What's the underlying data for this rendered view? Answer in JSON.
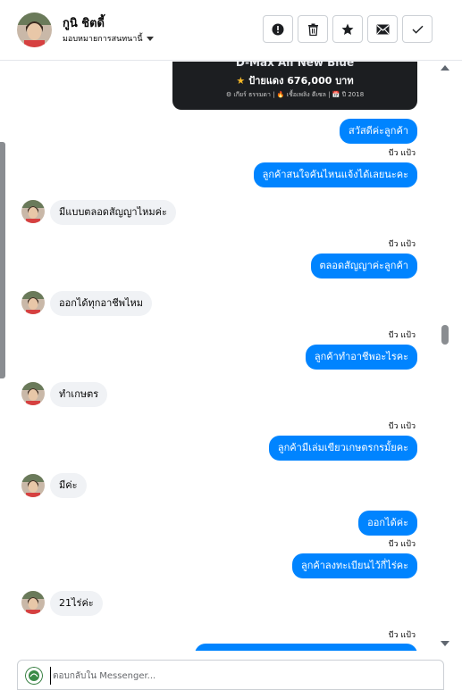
{
  "header": {
    "contact_name": "กูนิ ชิตดี้",
    "assign_label": "มอบหมายการสนทนานี้",
    "actions": [
      {
        "icon": "exclamation-icon"
      },
      {
        "icon": "trash-icon"
      },
      {
        "icon": "star-icon"
      },
      {
        "icon": "envelope-icon"
      },
      {
        "icon": "check-icon"
      }
    ]
  },
  "card": {
    "title": "D-Max All New Blue",
    "price": "ป้ายแดง 676,000 บาท",
    "specs": "⚙ เกียร์ ธรรมดา  |  🔥 เชื้อเพลิง ดีเซล  |  📅 ปี 2018"
  },
  "messages": [
    {
      "dir": "out",
      "text": "สวัสดีค่ะลูกค้า"
    },
    {
      "dir": "seen",
      "text": "บีว แป้ว"
    },
    {
      "dir": "out",
      "text": "ลูกค้าสนใจคันไหนแจ้งได้เลยนะคะ"
    },
    {
      "dir": "in",
      "text": "มีแบบตลอดสัญญาไหมค่ะ"
    },
    {
      "dir": "seen",
      "text": "บีว แป้ว"
    },
    {
      "dir": "out",
      "text": "ตลอดสัญญาค่ะลูกค้า"
    },
    {
      "dir": "in",
      "text": "ออกได้ทุกอาชีพไหม"
    },
    {
      "dir": "seen",
      "text": "บีว แป้ว"
    },
    {
      "dir": "out",
      "text": "ลูกค้าทำอาชีพอะไรคะ"
    },
    {
      "dir": "in",
      "text": "ทำเกษตร"
    },
    {
      "dir": "seen",
      "text": "บีว แป้ว"
    },
    {
      "dir": "out",
      "text": "ลูกค้ามีเล่มเขียวเกษตรกรมั้ยคะ"
    },
    {
      "dir": "in",
      "text": "มีค่ะ"
    },
    {
      "dir": "out",
      "text": "ออกได้ค่ะ"
    },
    {
      "dir": "seen",
      "text": "บีว แป้ว"
    },
    {
      "dir": "out",
      "text": "ลูกค้าลงทะเบียนไว้กี่ไร่คะ"
    },
    {
      "dir": "in",
      "text": "21ไร่ค่ะ"
    },
    {
      "dir": "seen",
      "text": "บีว แป้ว"
    }
  ],
  "composer": {
    "placeholder": "ตอบกลับใน Messenger..."
  },
  "colors": {
    "outgoing_bubble": "#0084ff",
    "incoming_bubble": "#f0f2f5",
    "card_bg": "#1c1e21"
  }
}
